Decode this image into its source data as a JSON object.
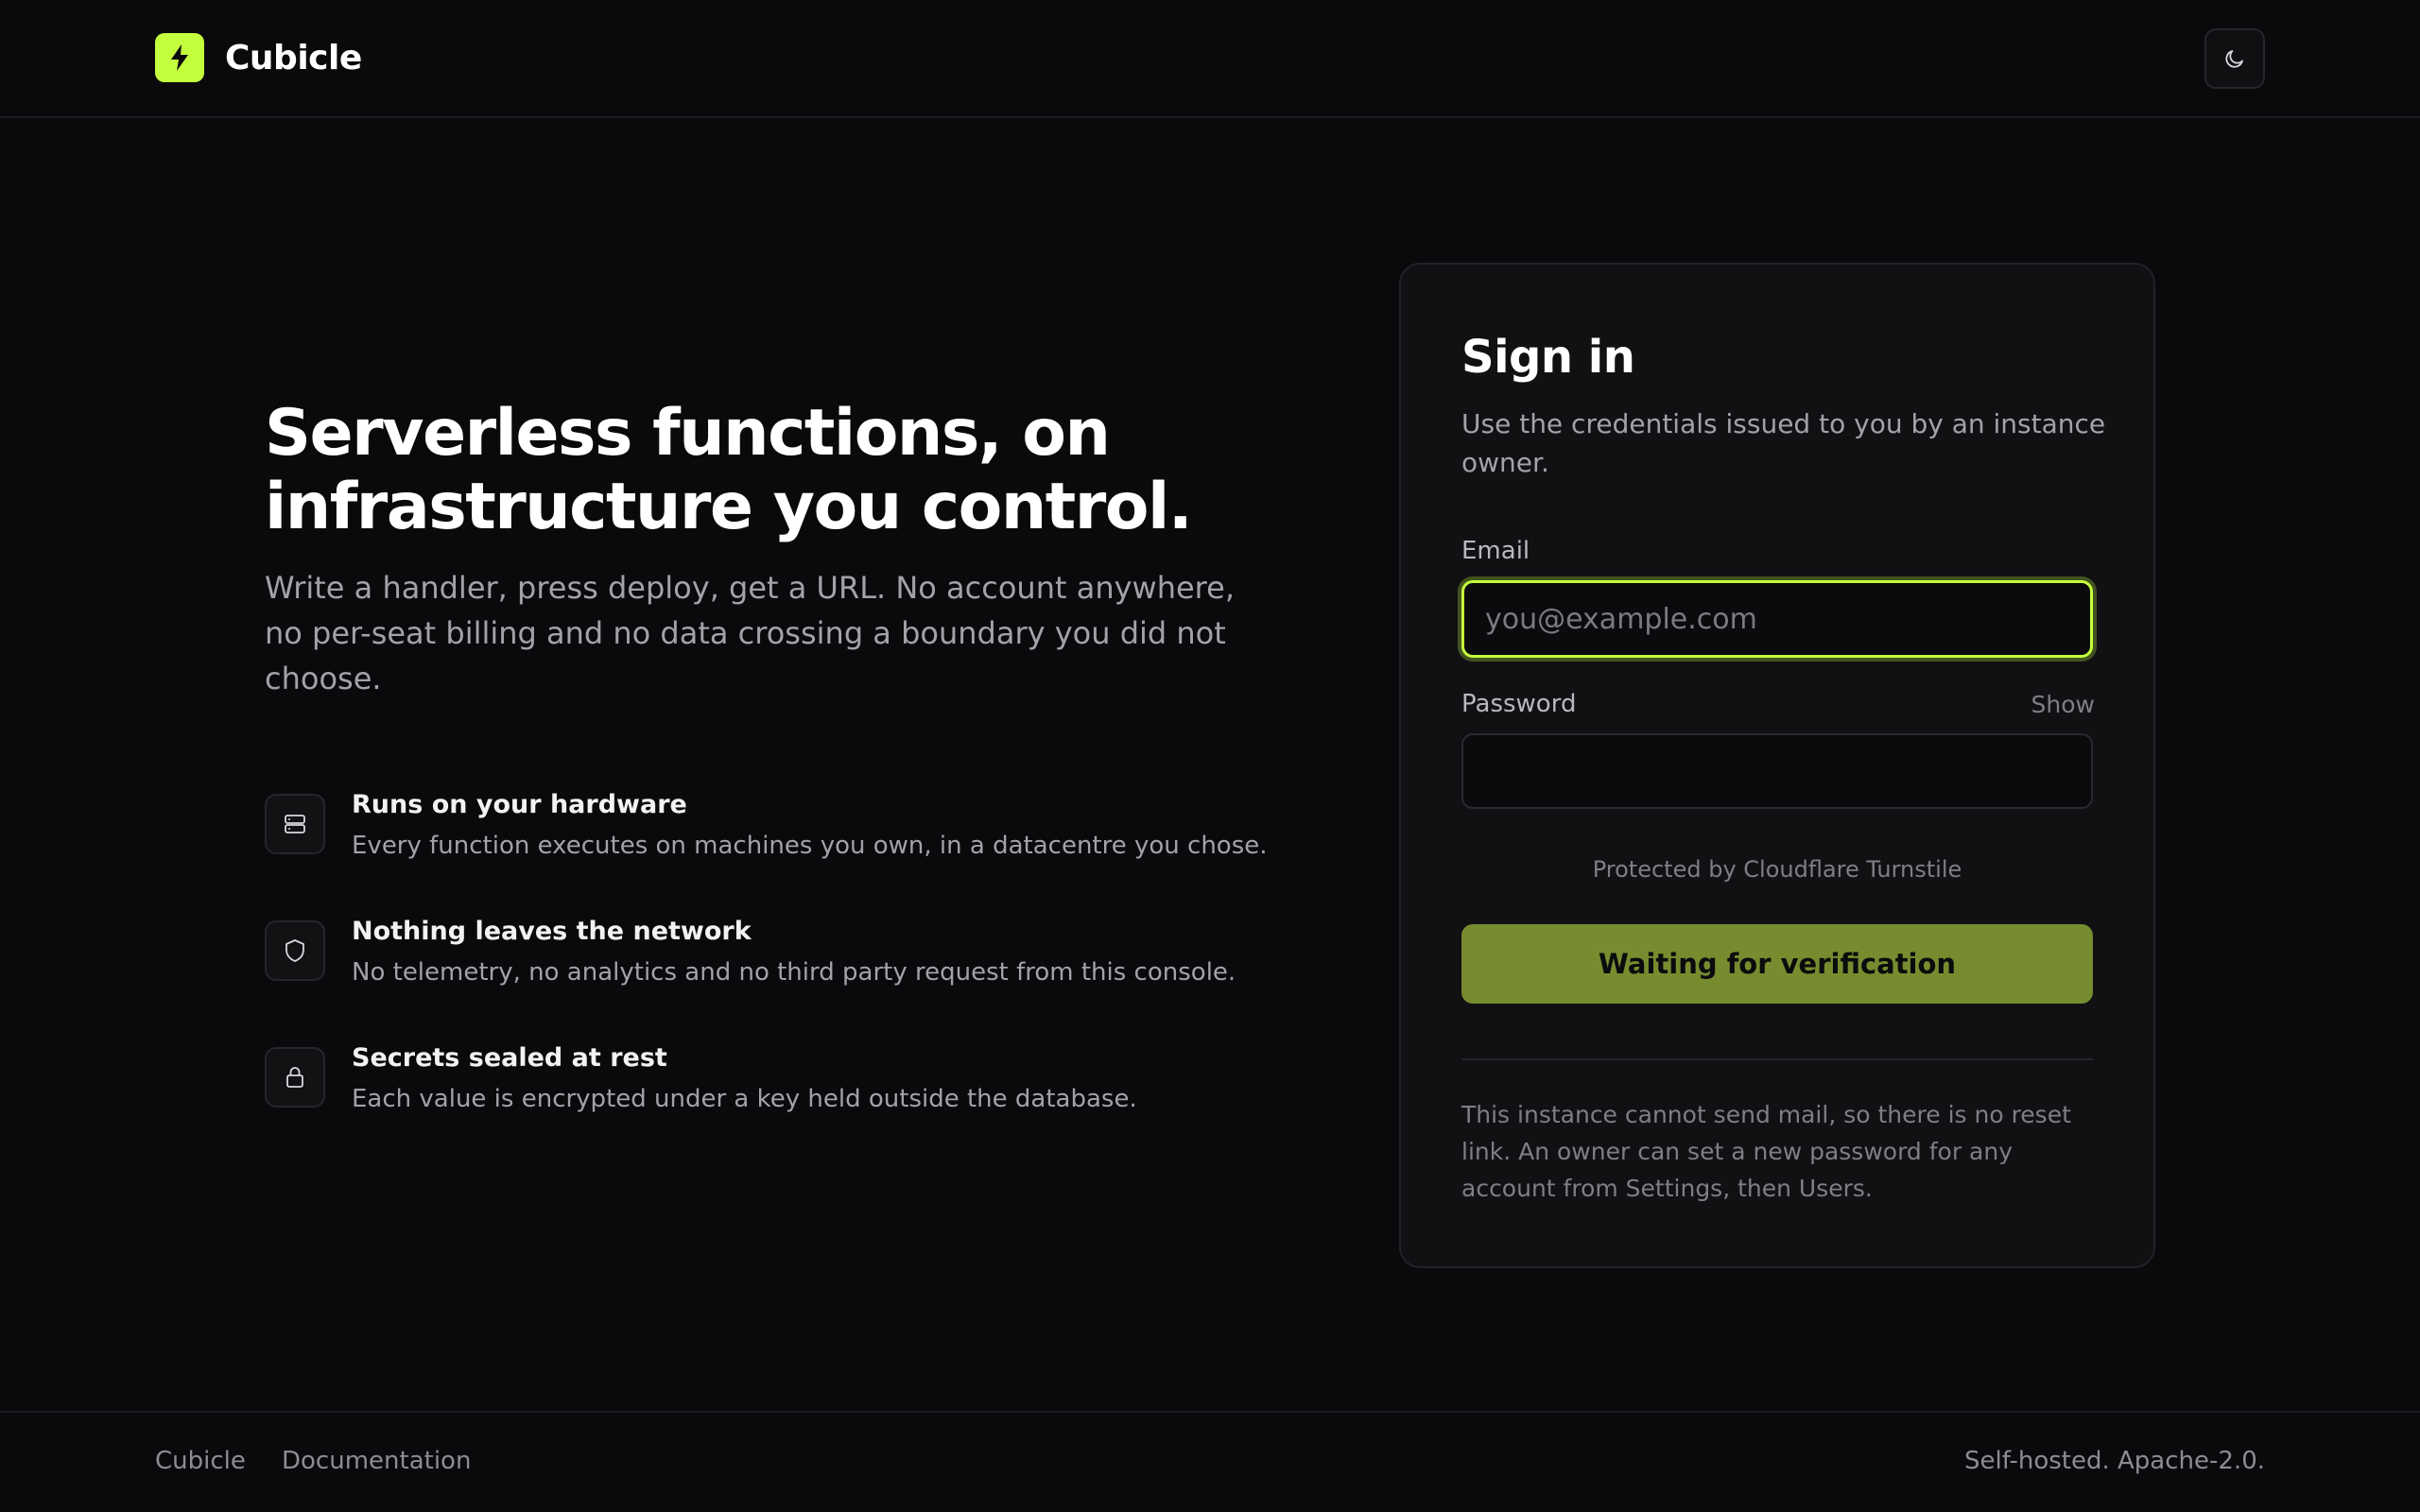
{
  "header": {
    "brand_name": "Cubicle"
  },
  "hero": {
    "title_line1": "Serverless functions, on",
    "title_line2": "infrastructure you control.",
    "subtitle": "Write a handler, press deploy, get a URL. No account anywhere, no per-seat billing and no data crossing a boundary you did not choose."
  },
  "features": [
    {
      "icon": "server-icon",
      "title": "Runs on your hardware",
      "description": "Every function executes on machines you own, in a datacentre you chose."
    },
    {
      "icon": "shield-icon",
      "title": "Nothing leaves the network",
      "description": "No telemetry, no analytics and no third party request from this console."
    },
    {
      "icon": "lock-icon",
      "title": "Secrets sealed at rest",
      "description": "Each value is encrypted under a key held outside the database."
    }
  ],
  "signin": {
    "title": "Sign in",
    "subtitle": "Use the credentials issued to you by an instance owner.",
    "email_label": "Email",
    "email_placeholder": "you@example.com",
    "email_value": "",
    "password_label": "Password",
    "show_label": "Show",
    "password_value": "",
    "turnstile_text": "Protected by Cloudflare Turnstile",
    "submit_label": "Waiting for verification",
    "note": "This instance cannot send mail, so there is no reset link. An owner can set a new password for any account from Settings, then Users."
  },
  "footer": {
    "link_home": "Cubicle",
    "link_docs": "Documentation",
    "license": "Self-hosted. Apache-2.0."
  },
  "colors": {
    "accent": "#c4ff3d",
    "button_disabled": "#778c2f",
    "background": "#0a0a0c",
    "card": "#111114"
  }
}
